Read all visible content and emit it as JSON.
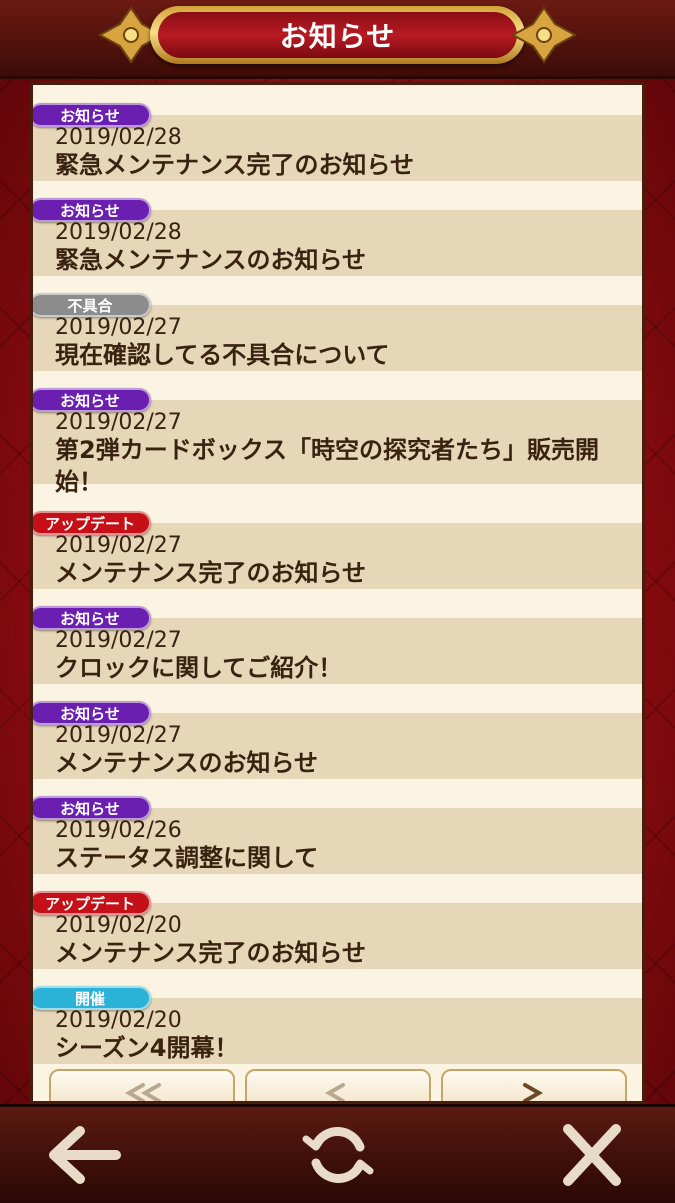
{
  "header": {
    "title": "お知らせ"
  },
  "colors": {
    "badge_info": "#6a1fb0",
    "badge_bug": "#8c8c8c",
    "badge_update": "#c41016",
    "badge_event": "#2ab3d6",
    "text": "#3a2210"
  },
  "news": [
    {
      "badge": "お知らせ",
      "badge_type": "info",
      "date": "2019/02/28",
      "title": "緊急メンテナンス完了のお知らせ"
    },
    {
      "badge": "お知らせ",
      "badge_type": "info",
      "date": "2019/02/28",
      "title": "緊急メンテナンスのお知らせ"
    },
    {
      "badge": "不具合",
      "badge_type": "bug",
      "date": "2019/02/27",
      "title": "現在確認してる不具合について"
    },
    {
      "badge": "お知らせ",
      "badge_type": "info",
      "date": "2019/02/27",
      "title": "第2弾カードボックス「時空の探究者たち」販売開始！"
    },
    {
      "badge": "アップデート",
      "badge_type": "update",
      "date": "2019/02/27",
      "title": "メンテナンス完了のお知らせ"
    },
    {
      "badge": "お知らせ",
      "badge_type": "info",
      "date": "2019/02/27",
      "title": "クロックに関してご紹介！"
    },
    {
      "badge": "お知らせ",
      "badge_type": "info",
      "date": "2019/02/27",
      "title": "メンテナンスのお知らせ"
    },
    {
      "badge": "お知らせ",
      "badge_type": "info",
      "date": "2019/02/26",
      "title": "ステータス調整に関して"
    },
    {
      "badge": "アップデート",
      "badge_type": "update",
      "date": "2019/02/20",
      "title": "メンテナンス完了のお知らせ"
    },
    {
      "badge": "開催",
      "badge_type": "event",
      "date": "2019/02/20",
      "title": "シーズン4開幕！"
    }
  ],
  "pagination": {
    "icons": [
      "double-chevron-left-icon",
      "chevron-left-icon",
      "chevron-right-icon"
    ]
  },
  "footer": {
    "icons": [
      "back-arrow-icon",
      "refresh-icon",
      "close-icon"
    ]
  }
}
